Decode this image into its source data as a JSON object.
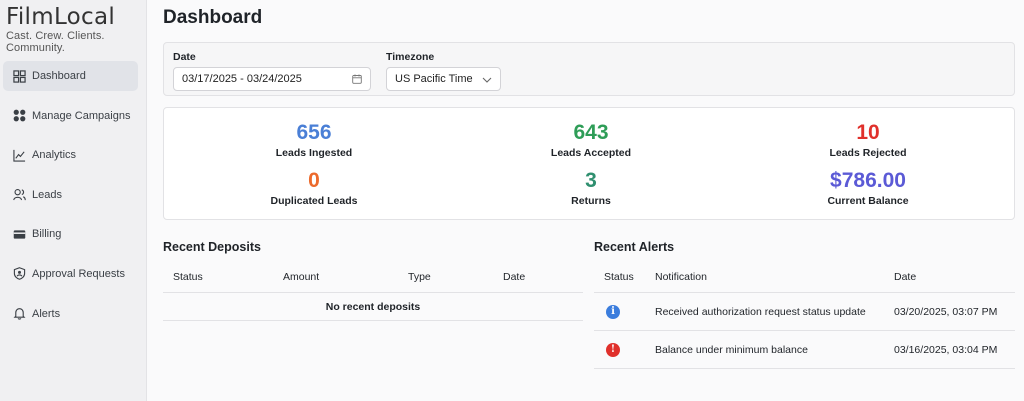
{
  "brand": {
    "name": "FilmLocal",
    "tagline": "Cast. Crew. Clients. Community."
  },
  "sidebar": {
    "items": [
      {
        "label": "Dashboard",
        "icon": "grid-icon",
        "active": true
      },
      {
        "label": "Manage Campaigns",
        "icon": "dots-icon"
      },
      {
        "label": "Analytics",
        "icon": "chart-line-icon"
      },
      {
        "label": "Leads",
        "icon": "users-icon"
      },
      {
        "label": "Billing",
        "icon": "card-icon"
      },
      {
        "label": "Approval Requests",
        "icon": "shield-user-icon"
      },
      {
        "label": "Alerts",
        "icon": "bell-icon"
      }
    ]
  },
  "page": {
    "title": "Dashboard"
  },
  "filters": {
    "date_label": "Date",
    "date_value": "03/17/2025 - 03/24/2025",
    "timezone_label": "Timezone",
    "timezone_value": "US Pacific Time"
  },
  "stats": [
    {
      "value": "656",
      "label": "Leads Ingested",
      "color": "#4a7fd6"
    },
    {
      "value": "643",
      "label": "Leads Accepted",
      "color": "#2e9d57"
    },
    {
      "value": "10",
      "label": "Leads Rejected",
      "color": "#e0302b"
    },
    {
      "value": "0",
      "label": "Duplicated Leads",
      "color": "#ec6a2c"
    },
    {
      "value": "3",
      "label": "Returns",
      "color": "#2f8f6f"
    },
    {
      "value": "$786.00",
      "label": "Current Balance",
      "color": "#5b5ad6"
    }
  ],
  "deposits": {
    "title": "Recent Deposits",
    "columns": [
      "Status",
      "Amount",
      "Type",
      "Date"
    ],
    "empty_text": "No recent deposits"
  },
  "alerts": {
    "title": "Recent Alerts",
    "columns": [
      "Status",
      "Notification",
      "Date"
    ],
    "rows": [
      {
        "status": "info",
        "status_glyph": "i",
        "status_color": "#3b7ddd",
        "notification": "Received authorization request status update",
        "date": "03/20/2025, 03:07 PM"
      },
      {
        "status": "error",
        "status_glyph": "!",
        "status_color": "#e0302b",
        "notification": "Balance under minimum balance",
        "date": "03/16/2025, 03:04 PM"
      }
    ]
  }
}
